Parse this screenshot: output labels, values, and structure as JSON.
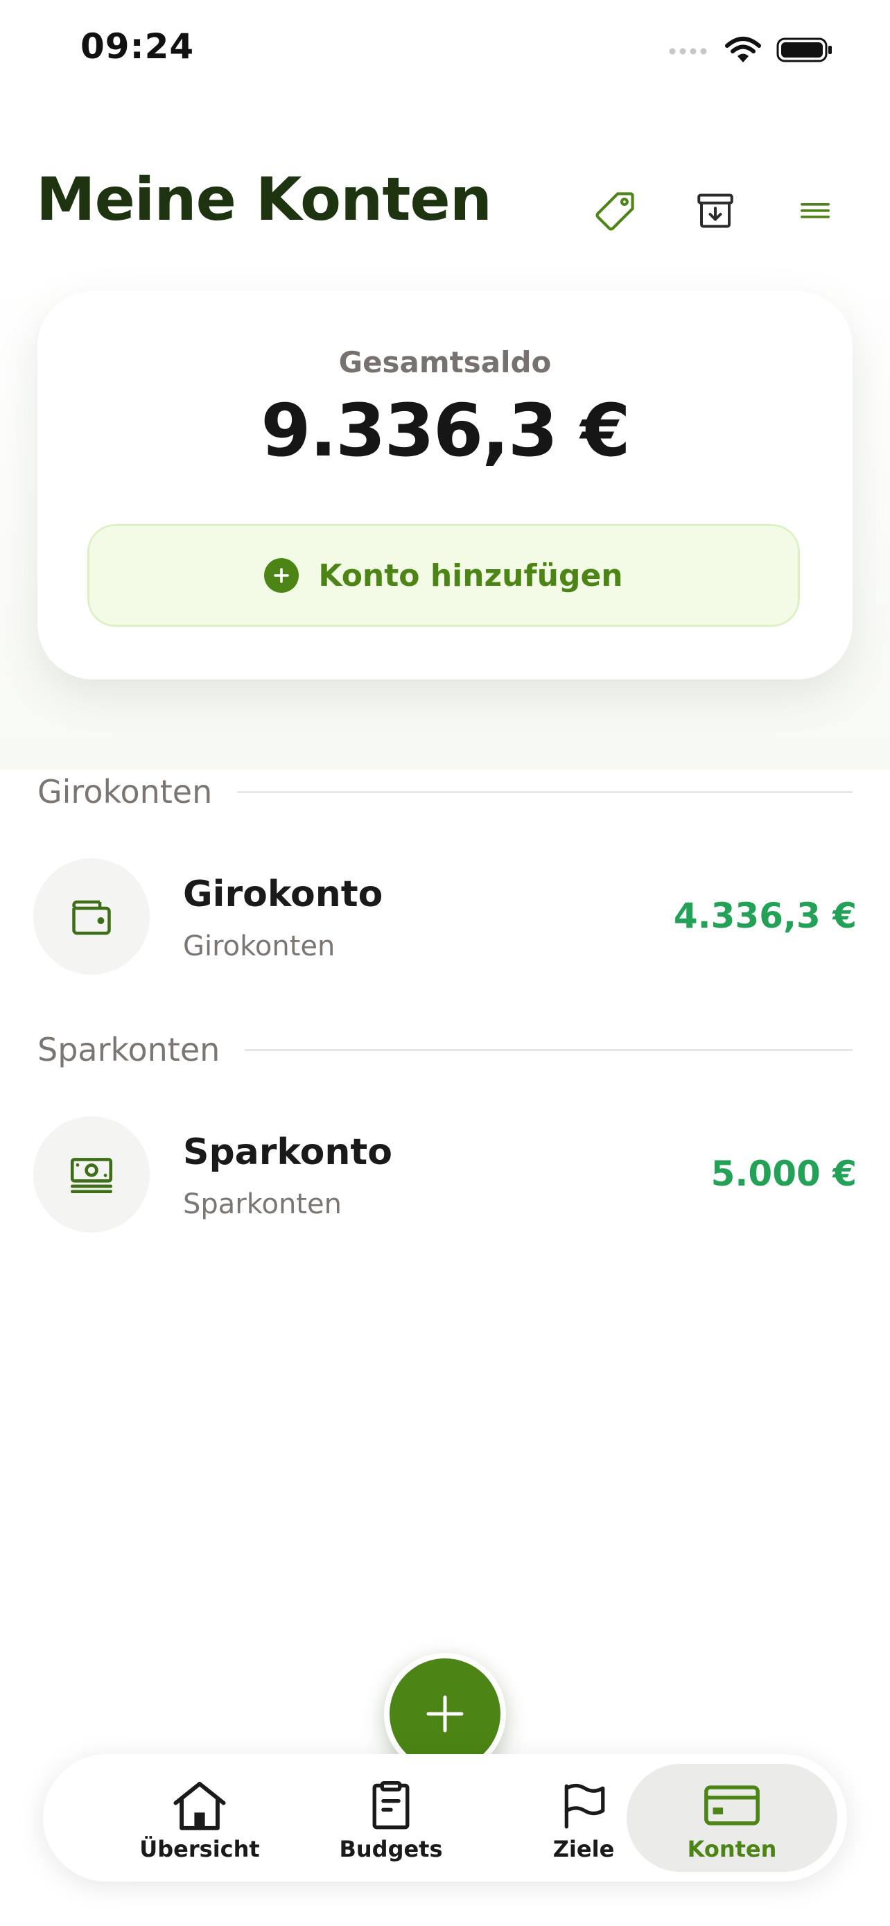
{
  "status_bar": {
    "time": "09:24"
  },
  "header": {
    "title": "Meine Konten"
  },
  "summary": {
    "label": "Gesamtsaldo",
    "total": "9.336,3 €",
    "add_button_label": "Konto hinzufügen"
  },
  "sections": [
    {
      "title": "Girokonten",
      "accounts": [
        {
          "name": "Girokonto",
          "type": "Girokonten",
          "balance": "4.336,3 €",
          "icon": "wallet-icon"
        }
      ]
    },
    {
      "title": "Sparkonten",
      "accounts": [
        {
          "name": "Sparkonto",
          "type": "Sparkonten",
          "balance": "5.000 €",
          "icon": "banknote-icon"
        }
      ]
    }
  ],
  "tabbar": {
    "items": [
      {
        "label": "Übersicht",
        "icon": "home-icon"
      },
      {
        "label": "Budgets",
        "icon": "clipboard-icon"
      },
      {
        "label": "Ziele",
        "icon": "flag-icon"
      },
      {
        "label": "Konten",
        "icon": "card-icon",
        "active": true
      }
    ]
  },
  "colors": {
    "brand": "#4c8515",
    "title": "#1e3410",
    "positive_amount": "#23a257",
    "add_button_bg": "#f3fbe6"
  }
}
